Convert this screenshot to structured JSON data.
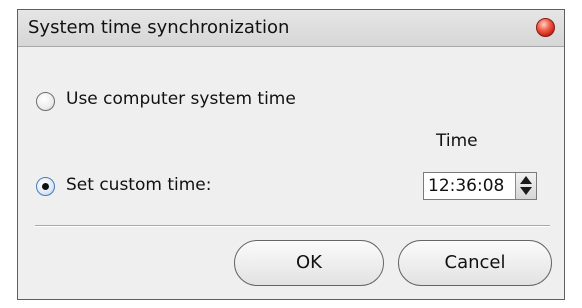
{
  "dialog": {
    "title": "System time synchronization",
    "close_icon": "close-icon",
    "options": {
      "computer_time_label": "Use computer system time",
      "custom_time_label": "Set custom time:",
      "selected": "custom"
    },
    "time": {
      "heading": "Time",
      "value": "12:36:08"
    },
    "buttons": {
      "ok": "OK",
      "cancel": "Cancel"
    }
  }
}
